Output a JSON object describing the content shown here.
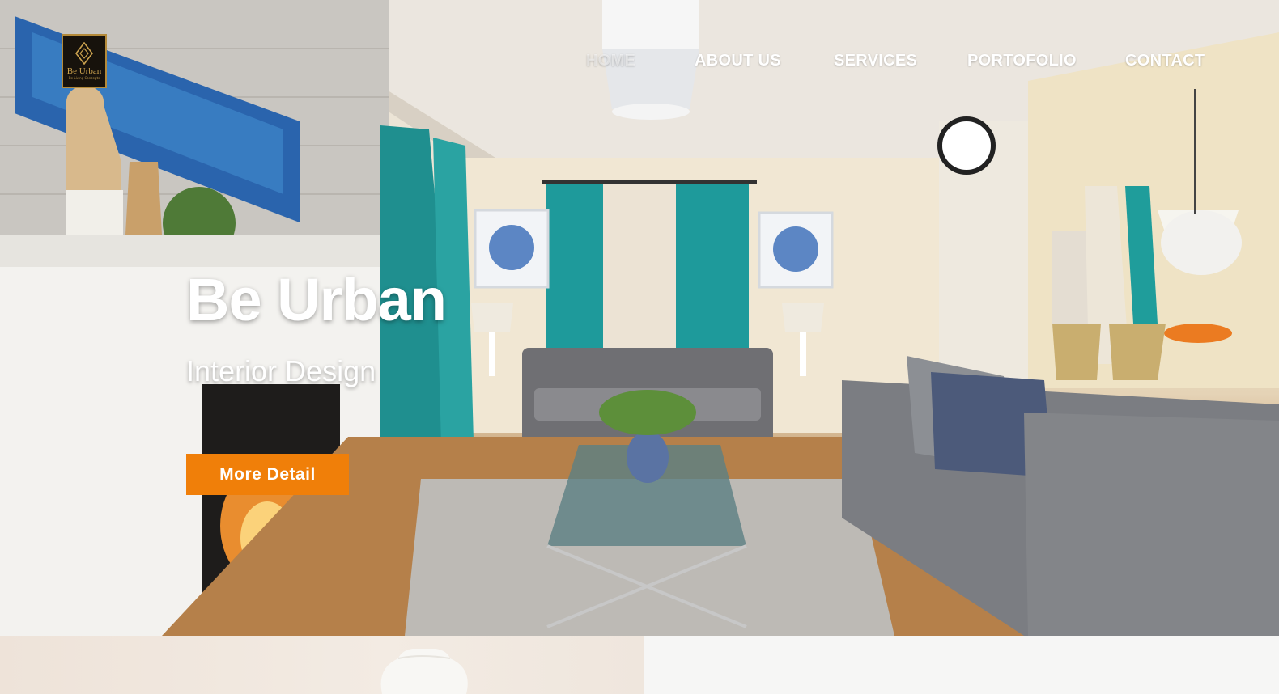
{
  "brand": {
    "logo_text": "Be Urban",
    "logo_tagline": "Be Living Concepts",
    "accent_gold": "#b48a3a",
    "accent_orange": "#f07f09"
  },
  "nav": {
    "items": [
      {
        "label": "HOME",
        "active": true
      },
      {
        "label": "ABOUT US",
        "active": false
      },
      {
        "label": "SERVICES",
        "active": false
      },
      {
        "label": "PORTOFOLIO",
        "active": false
      },
      {
        "label": "CONTACT",
        "active": false
      }
    ]
  },
  "hero": {
    "title": "Be Urban",
    "subtitle": "Interior Design",
    "button_label": "More Detail",
    "image": "living-room-interior-photo"
  },
  "sections": {
    "left_image": "vase-photo",
    "right_background": "#f6f6f5"
  }
}
